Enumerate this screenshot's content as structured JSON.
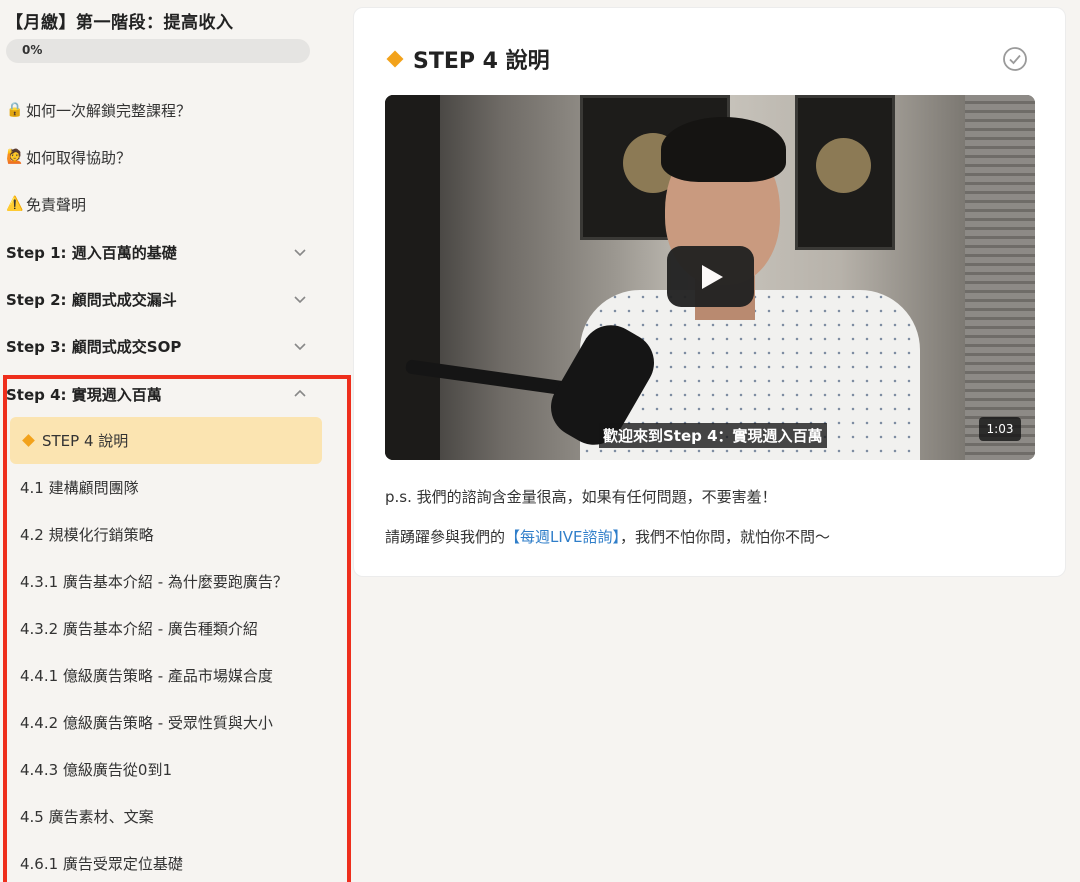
{
  "sidebar": {
    "course_title": "【月繳】第一階段：提高收入",
    "progress": {
      "percent_value": 0,
      "label": "0%"
    },
    "links": [
      {
        "icon": "lock-icon",
        "emoji": "🔒",
        "label": "如何一次解鎖完整課程？"
      },
      {
        "icon": "raised-hand-person-icon",
        "emoji": "🙋",
        "label": "如何取得協助？"
      },
      {
        "icon": "warning-icon",
        "emoji": "⚠️",
        "label": "免責聲明"
      }
    ],
    "sections": [
      {
        "label": "Step 1: 週入百萬的基礎",
        "expanded": false
      },
      {
        "label": "Step 2: 顧問式成交漏斗",
        "expanded": false
      },
      {
        "label": "Step 3: 顧問式成交SOP",
        "expanded": false
      },
      {
        "label": "Step 4: 實現週入百萬",
        "expanded": true
      }
    ],
    "lessons": [
      {
        "label": "STEP 4 說明",
        "active": true
      },
      {
        "label": "4.1 建構顧問團隊",
        "active": false
      },
      {
        "label": "4.2 規模化行銷策略",
        "active": false
      },
      {
        "label": "4.3.1 廣告基本介紹 - 為什麼要跑廣告？",
        "active": false
      },
      {
        "label": "4.3.2 廣告基本介紹 - 廣告種類介紹",
        "active": false
      },
      {
        "label": "4.4.1 億級廣告策略 - 產品市場媒合度",
        "active": false
      },
      {
        "label": "4.4.2 億級廣告策略 - 受眾性質與大小",
        "active": false
      },
      {
        "label": "4.4.3 億級廣告從0到1",
        "active": false
      },
      {
        "label": "4.5 廣告素材、文案",
        "active": false
      },
      {
        "label": "4.6.1 廣告受眾定位基礎",
        "active": false
      }
    ]
  },
  "main": {
    "title": "STEP 4 說明",
    "video": {
      "subtitle": "歡迎來到Step 4：實現週入百萬",
      "duration": "1:03"
    },
    "paragraph1": "p.s. 我們的諮詢含金量很高，如果有任何問題，不要害羞！",
    "paragraph2_before": "請踴躍參與我們的",
    "paragraph2_link": "【每週LIVE諮詢】",
    "paragraph2_after": "，我們不怕你問，就怕你不問～"
  },
  "colors": {
    "accent": "#f2a21b",
    "active_lesson_bg": "#fbe4b1",
    "link": "#2f7ec9",
    "annotation_border": "#ee2e1c"
  }
}
